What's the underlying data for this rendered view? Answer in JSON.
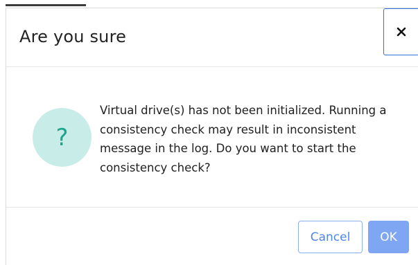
{
  "dialog": {
    "title": "Are you sure",
    "close_icon": "close-icon",
    "help_icon_glyph": "?",
    "message": "Virtual drive(s) has not been initialized. Running a consistency check may result in inconsistent message in the log. Do you want to start the consistency check?",
    "buttons": {
      "cancel_label": "Cancel",
      "ok_label": "OK"
    }
  },
  "colors": {
    "accent": "#2f6fd6",
    "ok_button": "#7ea6f2",
    "help_circle": "#c8ede8",
    "help_glyph": "#1fa58e"
  }
}
